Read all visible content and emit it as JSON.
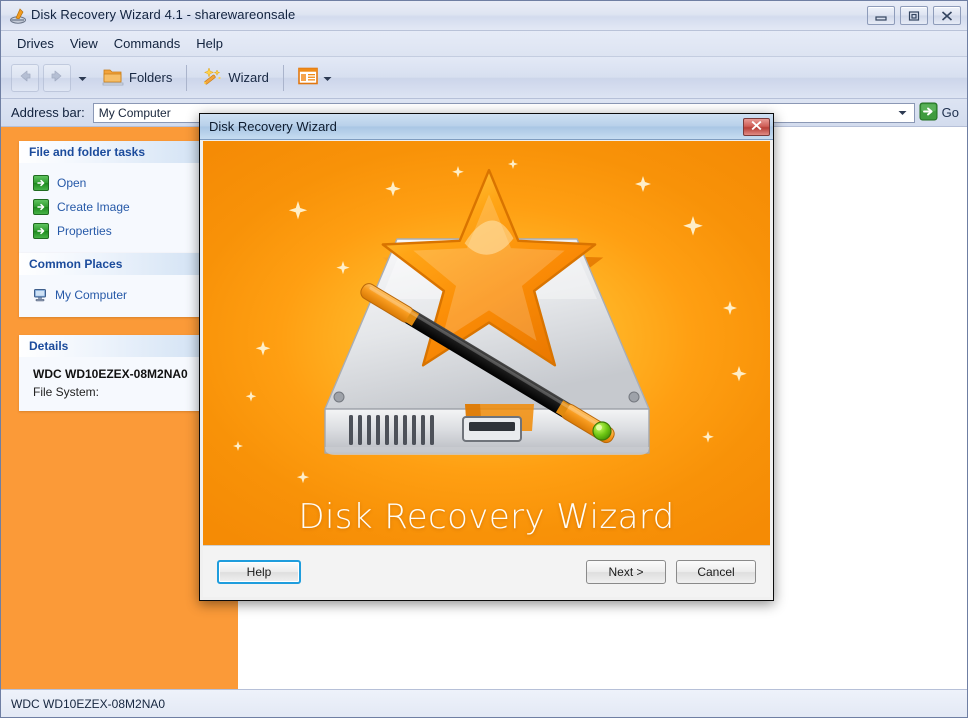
{
  "window": {
    "title": "Disk Recovery Wizard 4.1 - sharewareonsale",
    "icon": "disk-recovery-app-icon",
    "controls": [
      {
        "name": "minimize",
        "glyph": "minimize-icon"
      },
      {
        "name": "restore",
        "glyph": "restore-icon"
      },
      {
        "name": "close",
        "glyph": "close-icon"
      }
    ]
  },
  "menubar": {
    "items": [
      {
        "label": "Drives"
      },
      {
        "label": "View"
      },
      {
        "label": "Commands"
      },
      {
        "label": "Help"
      }
    ]
  },
  "toolbar": {
    "back_icon": "back-arrow-icon",
    "forward_icon": "forward-arrow-icon",
    "history_caret_icon": "chevron-down-icon",
    "folders_label": "Folders",
    "folders_icon": "folders-icon",
    "wizard_label": "Wizard",
    "wizard_icon": "magic-wand-icon",
    "views_icon": "views-list-icon",
    "views_caret_icon": "chevron-down-icon"
  },
  "address_bar": {
    "label": "Address bar:",
    "value": "My Computer",
    "placeholder": "My Computer",
    "dropdown_icon": "chevron-down-icon",
    "go_label": "Go",
    "go_icon": "green-arrow-go-icon"
  },
  "sidebar": {
    "background_color": "#fb9a38",
    "panels": [
      {
        "name": "file-and-folder-tasks",
        "header": "File and folder tasks",
        "tasks": [
          {
            "label": "Open",
            "icon": "green-arrow-icon"
          },
          {
            "label": "Create Image",
            "icon": "green-arrow-icon"
          },
          {
            "label": "Properties",
            "icon": "green-arrow-icon"
          }
        ]
      },
      {
        "name": "common-places",
        "header": "Common Places",
        "tasks": [
          {
            "label": "My Computer",
            "icon": "my-computer-icon"
          }
        ]
      },
      {
        "name": "details",
        "header": "Details",
        "rows": [
          {
            "text": "WDC WD10EZEX-08M2NA0",
            "strong": true
          },
          {
            "text": "File System:",
            "strong": false
          }
        ]
      }
    ]
  },
  "status_bar": {
    "text": "WDC WD10EZEX-08M2NA0"
  },
  "dialog": {
    "title": "Disk Recovery Wizard",
    "close_icon": "close-icon",
    "splash": {
      "title": "Disk Recovery Wizard",
      "illustration": "hard-drive-with-star-and-magic-wand",
      "accent_color": "#ff9f12"
    },
    "buttons": {
      "help": "Help",
      "next": "Next >",
      "cancel": "Cancel"
    }
  },
  "colors": {
    "sidebar_orange": "#fb9a38",
    "splash_orange": "#ff9f12",
    "panel_header_blue": "#1b4b9c",
    "link_blue": "#2659a8",
    "focus_blue": "#1f9ddd"
  }
}
